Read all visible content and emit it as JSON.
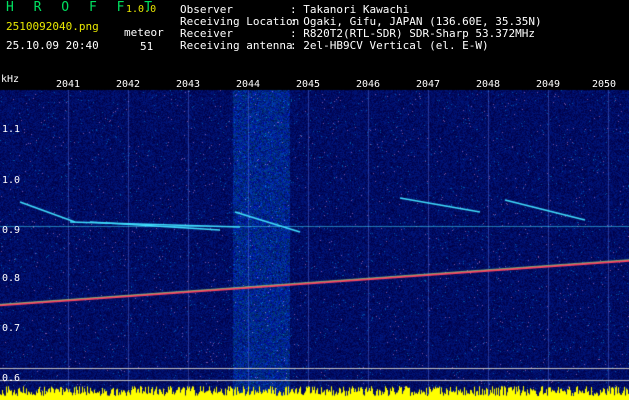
{
  "header": {
    "app_title": "H R O F F T",
    "app_version": "1.0.0",
    "filename": "2510092040.png",
    "timestamp": "25.10.09 20:40",
    "meteor_label": "meteor",
    "meteor_count": "51"
  },
  "info": [
    {
      "key": "Observer",
      "value": ": Takanori Kawachi"
    },
    {
      "key": "Receiving Location",
      "value": ": Ogaki, Gifu, JAPAN (136.60E, 35.35N)"
    },
    {
      "key": "Receiver",
      "value": ": R820T2(RTL-SDR) SDR-Sharp 53.372MHz"
    },
    {
      "key": "Receiving antenna",
      "value": ": 2el-HB9CV Vertical (el. E-W)"
    }
  ],
  "axes": {
    "y_unit": "kHz",
    "x_ticks": [
      "2041",
      "2042",
      "2043",
      "2044",
      "2045",
      "2046",
      "2047",
      "2048",
      "2049",
      "2050"
    ],
    "y_ticks": [
      "1.1",
      "1.0",
      "0.9",
      "0.8",
      "0.7",
      "0.6"
    ]
  },
  "chart_data": {
    "type": "heatmap",
    "x_ticks": [
      "2041",
      "2042",
      "2043",
      "2044",
      "2045",
      "2046",
      "2047",
      "2048",
      "2049",
      "2050"
    ],
    "ylabel": "kHz",
    "ylim": [
      0.59,
      1.18
    ],
    "carrier_line": {
      "x_start": "2040",
      "y_start": 0.755,
      "x_end": "2050",
      "y_end": 0.84
    },
    "echo_band": {
      "y": 0.905
    },
    "colors": {
      "background": "#000080",
      "carrier": "#ff4060",
      "echo": "#40e0ff",
      "level_bars": "#ffff00"
    }
  }
}
